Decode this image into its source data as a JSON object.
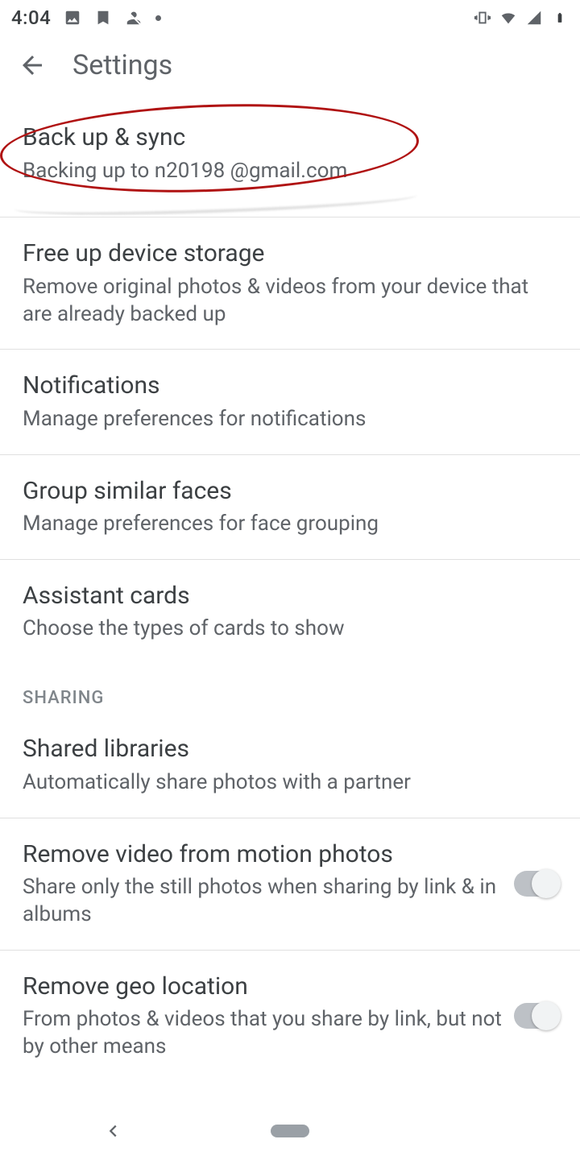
{
  "status": {
    "clock": "4:04"
  },
  "header": {
    "title": "Settings"
  },
  "items": {
    "backup": {
      "title": "Back up & sync",
      "sub": "Backing up to n20198  @gmail.com"
    },
    "freeup": {
      "title": "Free up device storage",
      "sub": "Remove original photos & videos from your device that are already backed up"
    },
    "notif": {
      "title": "Notifications",
      "sub": "Manage preferences for notifications"
    },
    "faces": {
      "title": "Group similar faces",
      "sub": "Manage preferences for face grouping"
    },
    "cards": {
      "title": "Assistant cards",
      "sub": "Choose the types of cards to show"
    }
  },
  "sections": {
    "sharing": "SHARING"
  },
  "sharing": {
    "libs": {
      "title": "Shared libraries",
      "sub": "Automatically share photos with a partner"
    },
    "motion": {
      "title": "Remove video from motion photos",
      "sub": "Share only the still photos when sharing by link & in albums"
    },
    "geo": {
      "title": "Remove geo location",
      "sub": "From photos & videos that you share by link, but not by other means"
    }
  }
}
